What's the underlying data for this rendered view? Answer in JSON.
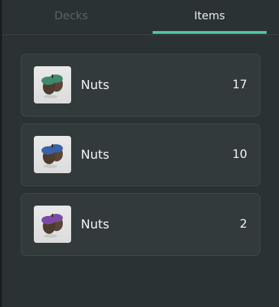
{
  "tabs": [
    {
      "label": "Decks",
      "active": false
    },
    {
      "label": "Items",
      "active": true
    }
  ],
  "accent_color": "#4fc6a4",
  "items": [
    {
      "name": "Nuts",
      "count": "17",
      "icon": "acorn-icon",
      "cap_color": "#3f8a6e"
    },
    {
      "name": "Nuts",
      "count": "10",
      "icon": "acorn-icon",
      "cap_color": "#3a62a8"
    },
    {
      "name": "Nuts",
      "count": "2",
      "icon": "acorn-icon",
      "cap_color": "#7a4aa6"
    }
  ]
}
